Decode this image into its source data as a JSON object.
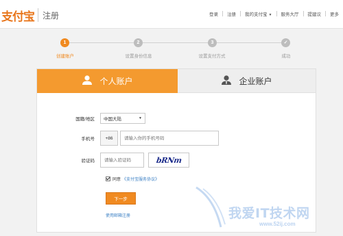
{
  "header": {
    "logo": "支付宝",
    "subtitle": "注册",
    "nav": {
      "login": "登录",
      "register": "注册",
      "my_alipay": "我的支付宝",
      "service": "服务大厅",
      "feedback": "提建议",
      "more": "更多"
    }
  },
  "steps": [
    {
      "num": "1",
      "label": "创建账户"
    },
    {
      "num": "2",
      "label": "设置身份信息"
    },
    {
      "num": "3",
      "label": "设置支付方式"
    },
    {
      "num": "✓",
      "label": "成功"
    }
  ],
  "tabs": {
    "personal": "个人账户",
    "business": "企业账户"
  },
  "form": {
    "region_label": "国籍/地区",
    "region_value": "中国大陆",
    "phone_label": "手机号",
    "phone_prefix": "+86",
    "phone_placeholder": "请输入你的手机号码",
    "code_label": "验证码",
    "code_placeholder": "请输入验证码",
    "captcha_text": "bRNm",
    "agree_text": "同意",
    "agree_link": "《支付宝服务协议》",
    "next_button": "下一步",
    "email_link": "使用邮箱注册"
  },
  "watermark": {
    "text": "我爱IT技术网",
    "url": "www.52ij.com"
  },
  "colors": {
    "accent": "#f08a21",
    "tab_active": "#f49a2f",
    "link": "#3a7fc4"
  }
}
